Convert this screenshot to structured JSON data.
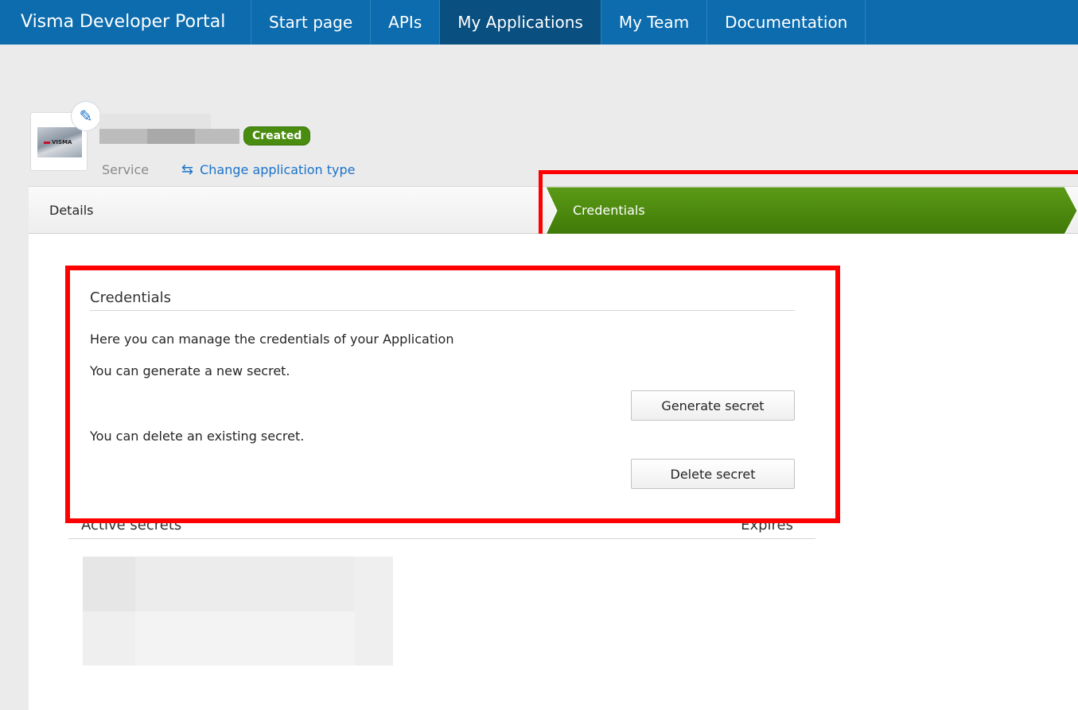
{
  "nav": {
    "brand": "Visma Developer Portal",
    "items": [
      {
        "label": "Start page",
        "active": false
      },
      {
        "label": "APIs",
        "active": false
      },
      {
        "label": "My Applications",
        "active": true
      },
      {
        "label": "My Team",
        "active": false
      },
      {
        "label": "Documentation",
        "active": false
      }
    ]
  },
  "app": {
    "logo_text": "VISMA",
    "status": "Created",
    "type": "Service",
    "change_type_label": "Change application type"
  },
  "wizard": {
    "steps": [
      {
        "label": "Details",
        "active": false
      },
      {
        "label": "Credentials",
        "active": true
      }
    ]
  },
  "credentials": {
    "title": "Credentials",
    "intro": "Here you can manage the credentials of your Application",
    "generate_text": "You can generate a new secret.",
    "generate_button": "Generate secret",
    "delete_text": "You can delete an existing secret.",
    "delete_button": "Delete secret"
  },
  "secrets": {
    "col_secret": "Active secrets",
    "col_expires": "Expires"
  },
  "colors": {
    "nav_bg": "#0c6cae",
    "nav_active": "#094f80",
    "accent_green": "#4a8c0f",
    "highlight": "#ff0000",
    "link": "#1a73c8"
  }
}
